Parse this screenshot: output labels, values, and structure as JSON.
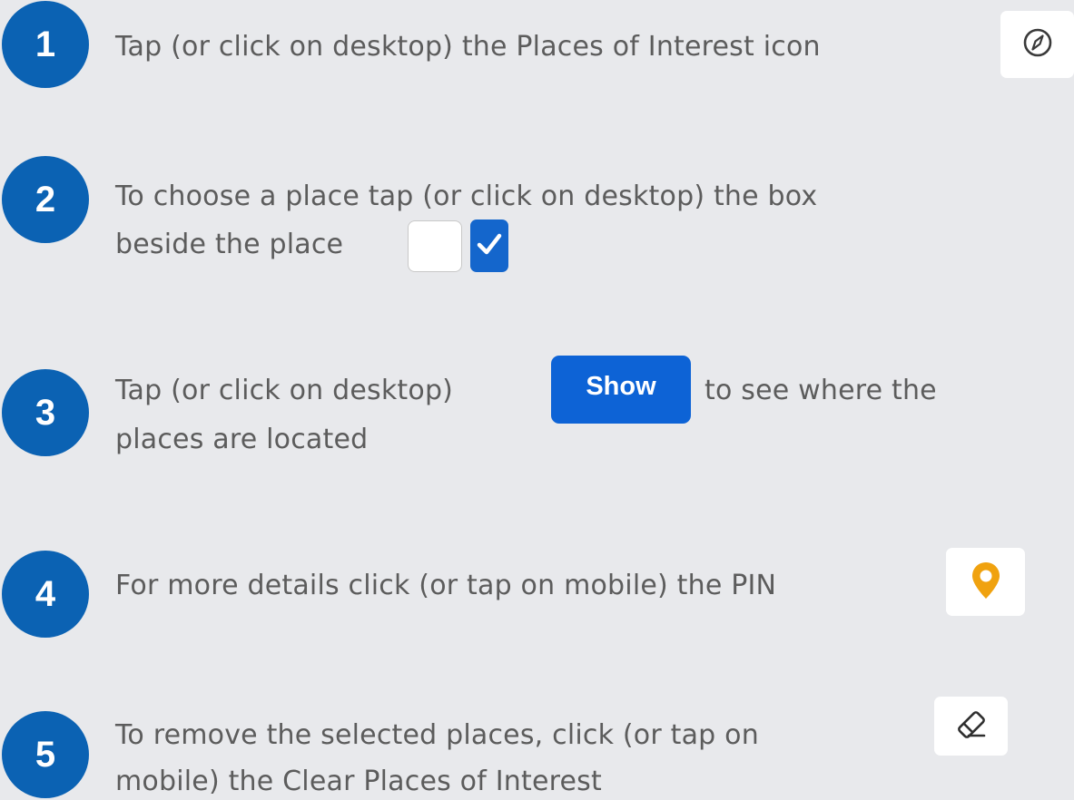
{
  "steps": [
    {
      "number": "1",
      "lines": [
        "Tap (or click on desktop) the Places of Interest icon"
      ]
    },
    {
      "number": "2",
      "lines": [
        "To choose a place tap (or click on desktop) the box",
        "beside the place"
      ]
    },
    {
      "number": "3",
      "lines": [
        "Tap (or click on desktop)",
        "to see where the",
        "places are located"
      ],
      "button_label": "Show"
    },
    {
      "number": "4",
      "lines": [
        "For more details click (or tap on mobile) the PIN"
      ]
    },
    {
      "number": "5",
      "lines": [
        "To remove the selected places, click (or tap on",
        "mobile) the Clear Places of Interest"
      ]
    }
  ],
  "icons": {
    "places_of_interest": "compass-icon",
    "checkbox_empty": "checkbox-unchecked",
    "checkbox_checked": "checkbox-checked",
    "pin": "map-pin-icon",
    "clear": "eraser-icon"
  },
  "colors": {
    "background": "#e8e9ec",
    "badge": "#0b62b3",
    "text": "#5c5c5c",
    "button": "#0d63d6",
    "checkbox_checked": "#1466cc",
    "pin": "#f0a20f"
  }
}
